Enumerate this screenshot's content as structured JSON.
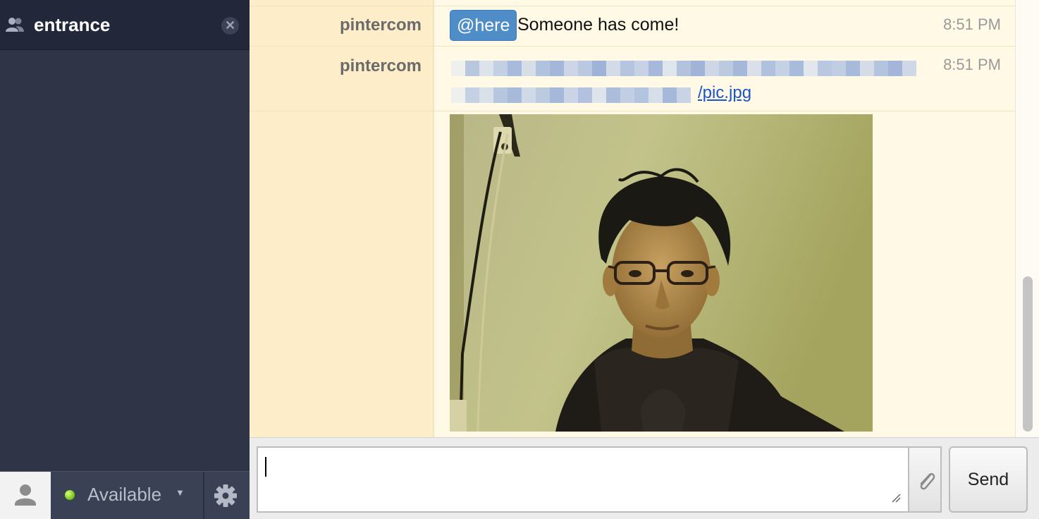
{
  "sidebar": {
    "room": {
      "name": "entrance",
      "icon": "group-icon",
      "close_glyph": "✕"
    },
    "status": {
      "label": "Available",
      "caret": "▼",
      "dot_color": "#7acb1c"
    }
  },
  "messages": [
    {
      "sender": "pintercom",
      "mention": "@here",
      "text": "Someone has come!",
      "time": "8:51 PM"
    },
    {
      "sender": "pintercom",
      "link_text": "/pic.jpg",
      "time": "8:51 PM",
      "attachment": "photo of a person wearing glasses and a dark hoodie"
    }
  ],
  "composer": {
    "input_value": "",
    "send_label": "Send",
    "attach_icon": "paperclip-icon"
  },
  "colors": {
    "sidebar": "#2f3447",
    "chat_bg": "#fff9e6",
    "name_col": "#fdedc8",
    "mention": "#4f8dc9",
    "link": "#1a55c9"
  }
}
